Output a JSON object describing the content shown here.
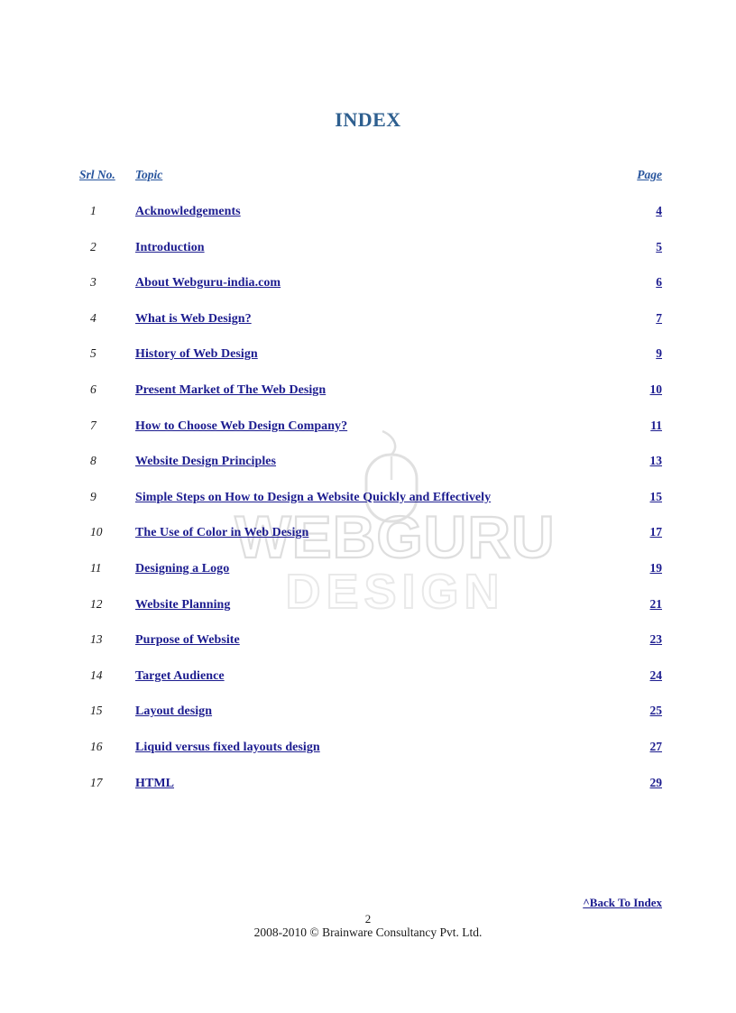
{
  "document": {
    "title": "INDEX"
  },
  "table": {
    "headers": {
      "srl": "Srl No.",
      "topic": "Topic ",
      "page": "Page "
    },
    "rows": [
      {
        "srl": "1",
        "topic": "Acknowledgements",
        "page": "4"
      },
      {
        "srl": "2",
        "topic": "Introduction",
        "page": "5"
      },
      {
        "srl": "3",
        "topic": "About Webguru-india.com",
        "page": "6"
      },
      {
        "srl": "4",
        "topic": "What is Web Design?",
        "page": "7"
      },
      {
        "srl": "5",
        "topic": "History of Web Design",
        "page": "9"
      },
      {
        "srl": "6",
        "topic": "Present Market of The Web Design",
        "page": "10"
      },
      {
        "srl": "7",
        "topic": "How to Choose Web Design Company?",
        "page": "11"
      },
      {
        "srl": "8",
        "topic": "Website Design Principles",
        "page": "13"
      },
      {
        "srl": "9",
        "topic": "Simple Steps on How to Design a Website Quickly and Effectively",
        "page": "15"
      },
      {
        "srl": "10",
        "topic": "The Use of Color in Web Design",
        "page": "17"
      },
      {
        "srl": "11",
        "topic": "Designing a Logo",
        "page": "19"
      },
      {
        "srl": "12",
        "topic": "Website Planning",
        "page": "21"
      },
      {
        "srl": "13",
        "topic": "Purpose of Website",
        "page": "23"
      },
      {
        "srl": "14",
        "topic": "Target Audience",
        "page": "24"
      },
      {
        "srl": "15",
        "topic": "Layout design",
        "page": "25"
      },
      {
        "srl": "16",
        "topic": "Liquid versus fixed layouts design",
        "page": "27"
      },
      {
        "srl": "17",
        "topic": "HTML",
        "page": "29"
      }
    ]
  },
  "watermark": {
    "line1": "WEBGURU",
    "line2": "DESIGN"
  },
  "footer": {
    "back_to_index": "^Back To Index",
    "page_number": "2",
    "copyright": "2008-2010 © Brainware Consultancy Pvt. Ltd."
  },
  "colors": {
    "title_blue": "#2e5f8f",
    "link_navy": "#1c1c8f",
    "header_blue": "#26539c",
    "body_text": "#1a1a1a",
    "page_background": "#ffffff",
    "watermark_gray": "#dcdcdc"
  }
}
